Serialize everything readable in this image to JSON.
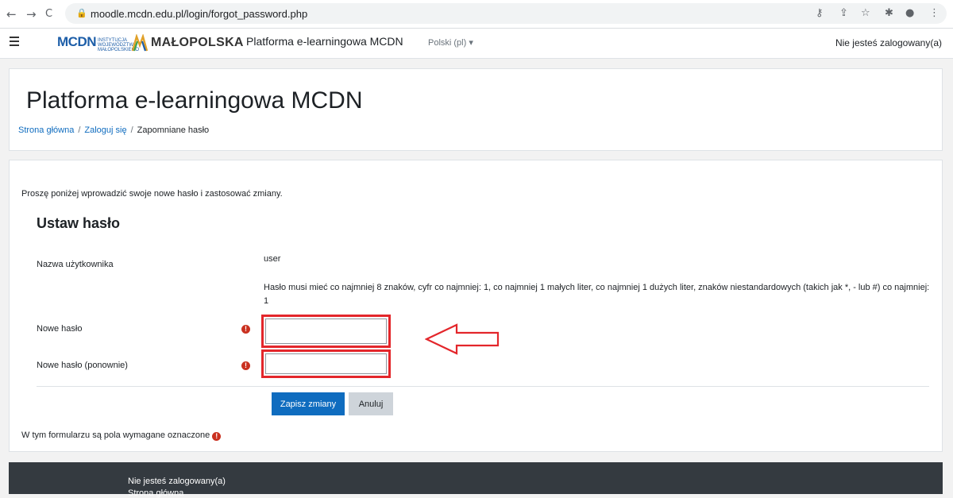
{
  "browser": {
    "back": "←",
    "forward": "→",
    "reload": "C",
    "url": "moodle.mcdn.edu.pl/login/forgot_password.php"
  },
  "navbar": {
    "logo_mcdn": "MCDN",
    "logo_sub": "INSTYTUCJA WOJEWÓDZTWA MAŁOPOLSKIEGO",
    "logo_malopolska": "MAŁOPOLSKA",
    "site_name": "Platforma e-learningowa MCDN",
    "language": "Polski (pl) ▾",
    "login_info": "Nie jesteś zalogowany(a)"
  },
  "header": {
    "title": "Platforma e-learningowa MCDN",
    "breadcrumb": [
      "Strona główna",
      "Zaloguj się",
      "Zapomniane hasło"
    ]
  },
  "form": {
    "intro": "Proszę poniżej wprowadzić swoje nowe hasło i zastosować zmiany.",
    "section_title": "Ustaw hasło",
    "username_label": "Nazwa użytkownika",
    "username_value": "user",
    "policy": "Hasło musi mieć co najmniej 8 znaków, cyfr co najmniej: 1, co najmniej 1 małych liter, co najmniej 1 dużych liter, znaków niestandardowych (takich jak *, - lub #) co najmniej: 1",
    "new_password_label": "Nowe hasło",
    "new_password_value": "",
    "new_password2_label": "Nowe hasło (ponownie)",
    "new_password2_value": "",
    "required_icon": "!",
    "save_button": "Zapisz zmiany",
    "cancel_button": "Anuluj",
    "required_note": "W tym formularzu są pola wymagane oznaczone"
  },
  "footer": {
    "login_info": "Nie jesteś zalogowany(a)",
    "home_link": "Strona główna"
  },
  "colors": {
    "accent": "#0f6cbf",
    "highlight": "#e3262b",
    "required": "#ca3120",
    "footer_bg": "#343a40"
  },
  "icons": {
    "lock": "lock-icon",
    "key": "key-icon",
    "share": "share-icon",
    "star": "star-icon",
    "extensions": "puzzle-icon",
    "profile": "profile-icon",
    "menu": "more-vert-icon",
    "hamburger": "hamburger-icon",
    "annotation": "left-arrow-icon"
  }
}
